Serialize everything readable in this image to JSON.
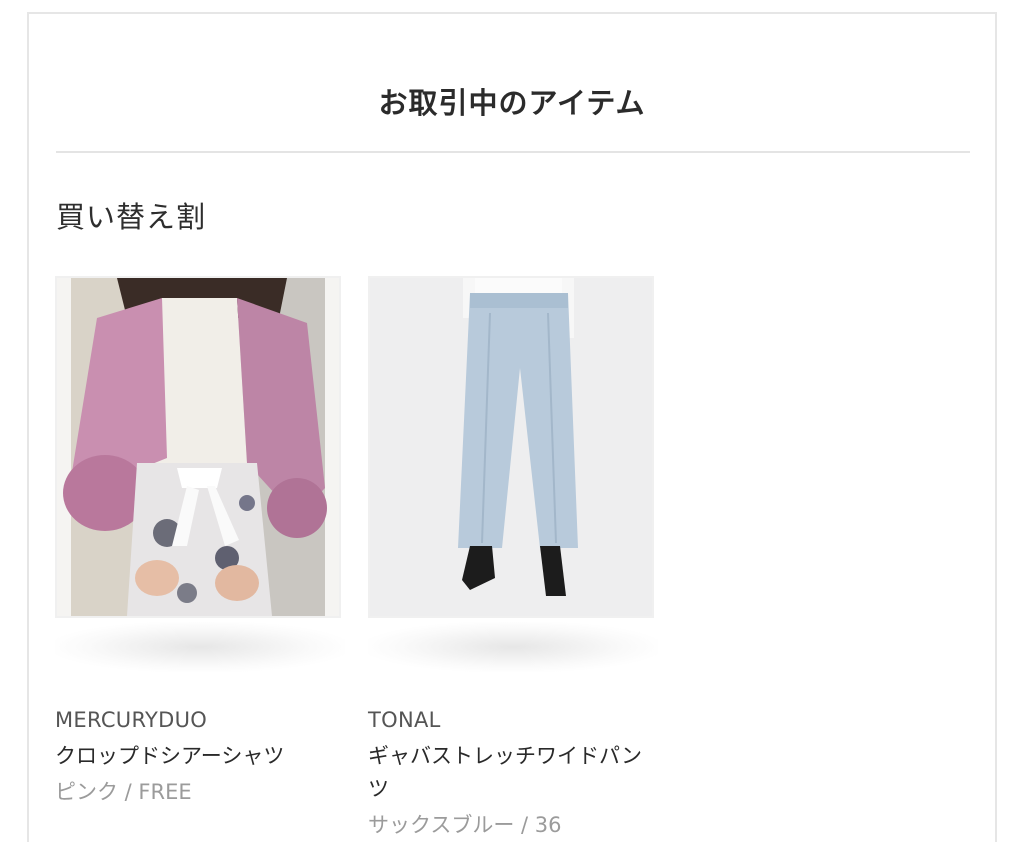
{
  "header": {
    "title": "お取引中のアイテム"
  },
  "section": {
    "title": "買い替え割"
  },
  "items": [
    {
      "brand": "MERCURYDUO",
      "name": "クロップドシアーシャツ",
      "variant": "ピンク / FREE",
      "image": "pink-sheer-shirt-photo"
    },
    {
      "brand": "TONAL",
      "name": "ギャバストレッチワイドパンツ",
      "variant": "サックスブルー / 36",
      "image": "light-blue-wide-pants-photo"
    }
  ]
}
